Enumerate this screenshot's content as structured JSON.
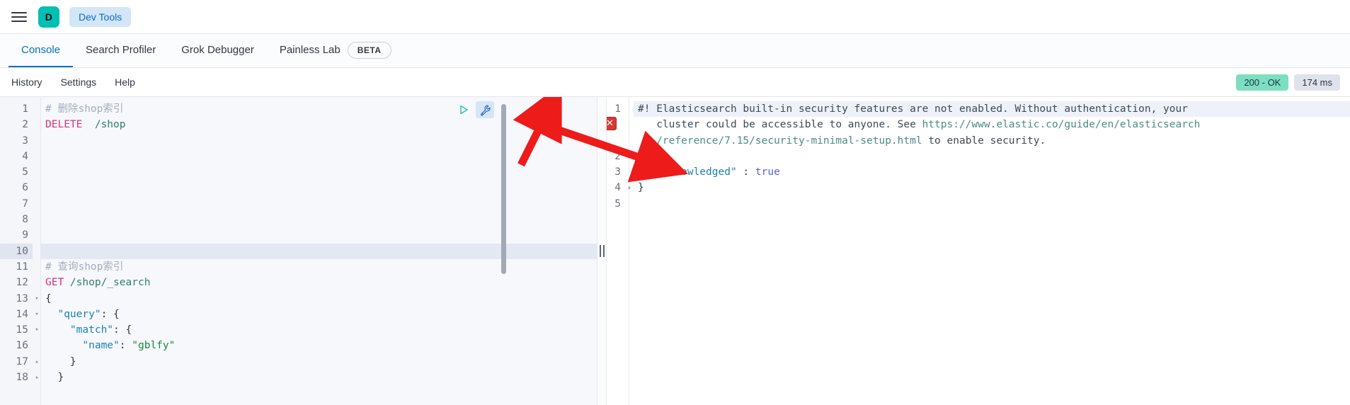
{
  "topbar": {
    "menu_icon": "hamburger-menu-icon",
    "avatar_letter": "D",
    "breadcrumb": "Dev Tools"
  },
  "tabs": [
    {
      "label": "Console",
      "active": true
    },
    {
      "label": "Search Profiler",
      "active": false
    },
    {
      "label": "Grok Debugger",
      "active": false
    },
    {
      "label": "Painless Lab",
      "active": false,
      "badge": "BETA"
    }
  ],
  "actions": {
    "links": [
      "History",
      "Settings",
      "Help"
    ],
    "status_code": "200 - OK",
    "duration": "174 ms",
    "play_icon": "play-triangle-icon",
    "wrench_icon": "wrench-icon"
  },
  "colors": {
    "accent_blue": "#0071c2",
    "teal_avatar": "#00BFB3",
    "status_ok_bg": "#7DDEC0",
    "status_time_bg": "#dfe2ea",
    "error_red": "#d63b33",
    "annotation_red": "#ee1b1b"
  },
  "request_editor": {
    "lines": [
      {
        "n": "1",
        "fold": "",
        "active": false,
        "tokens": [
          {
            "t": "# 删除shop索引",
            "c": "c-comment"
          }
        ]
      },
      {
        "n": "2",
        "fold": "",
        "active": false,
        "tokens": [
          {
            "t": "DELETE",
            "c": "c-method"
          },
          {
            "t": "  /shop",
            "c": "c-url"
          }
        ]
      },
      {
        "n": "3",
        "fold": "",
        "active": false,
        "tokens": []
      },
      {
        "n": "4",
        "fold": "",
        "active": false,
        "tokens": []
      },
      {
        "n": "5",
        "fold": "",
        "active": false,
        "tokens": []
      },
      {
        "n": "6",
        "fold": "",
        "active": false,
        "tokens": []
      },
      {
        "n": "7",
        "fold": "",
        "active": false,
        "tokens": []
      },
      {
        "n": "8",
        "fold": "",
        "active": false,
        "tokens": []
      },
      {
        "n": "9",
        "fold": "",
        "active": false,
        "tokens": []
      },
      {
        "n": "10",
        "fold": "",
        "active": true,
        "tokens": []
      },
      {
        "n": "11",
        "fold": "",
        "active": false,
        "tokens": [
          {
            "t": "# 查询shop索引",
            "c": "c-comment"
          }
        ]
      },
      {
        "n": "12",
        "fold": "",
        "active": false,
        "tokens": [
          {
            "t": "GET",
            "c": "c-method"
          },
          {
            "t": " /shop/_search",
            "c": "c-url"
          }
        ]
      },
      {
        "n": "13",
        "fold": "▾",
        "active": false,
        "tokens": [
          {
            "t": "{",
            "c": "c-punc"
          }
        ]
      },
      {
        "n": "14",
        "fold": "▾",
        "active": false,
        "tokens": [
          {
            "t": "  ",
            "c": "c-punc"
          },
          {
            "t": "\"query\"",
            "c": "c-key"
          },
          {
            "t": ": {",
            "c": "c-punc"
          }
        ]
      },
      {
        "n": "15",
        "fold": "▾",
        "active": false,
        "tokens": [
          {
            "t": "    ",
            "c": "c-punc"
          },
          {
            "t": "\"match\"",
            "c": "c-key"
          },
          {
            "t": ": {",
            "c": "c-punc"
          }
        ]
      },
      {
        "n": "16",
        "fold": "",
        "active": false,
        "tokens": [
          {
            "t": "      ",
            "c": "c-punc"
          },
          {
            "t": "\"name\"",
            "c": "c-key"
          },
          {
            "t": ": ",
            "c": "c-punc"
          },
          {
            "t": "\"gblfy\"",
            "c": "c-string"
          }
        ]
      },
      {
        "n": "17",
        "fold": "▴",
        "active": false,
        "tokens": [
          {
            "t": "    }",
            "c": "c-punc"
          }
        ]
      },
      {
        "n": "18",
        "fold": "▴",
        "active": false,
        "tokens": [
          {
            "t": "  }",
            "c": "c-punc"
          }
        ]
      }
    ]
  },
  "response_editor": {
    "lines": [
      {
        "n": "1",
        "fold": "",
        "warn": true,
        "tokens": [
          {
            "t": "#! Elasticsearch built-in security features are not enabled. Without authentication, your",
            "c": "c-warn"
          }
        ]
      },
      {
        "n": "",
        "fold": "",
        "warn": false,
        "tokens": [
          {
            "t": "   cluster could be accessible to anyone. See ",
            "c": "c-warn"
          },
          {
            "t": "https://www.elastic.co/guide/en/elasticsearch",
            "c": "c-link"
          }
        ]
      },
      {
        "n": "",
        "fold": "",
        "warn": false,
        "tokens": [
          {
            "t": "   ",
            "c": "c-warn"
          },
          {
            "t": "/reference/7.15/security-minimal-setup.html",
            "c": "c-link"
          },
          {
            "t": " to enable security.",
            "c": "c-warn"
          }
        ]
      },
      {
        "n": "2",
        "fold": "",
        "warn": false,
        "tokens": [
          {
            "t": "{",
            "c": "c-punc"
          }
        ]
      },
      {
        "n": "3",
        "fold": "",
        "warn": false,
        "tokens": [
          {
            "t": "  ",
            "c": "c-punc"
          },
          {
            "t": "\"acknowledged\"",
            "c": "c-key"
          },
          {
            "t": " : ",
            "c": "c-punc"
          },
          {
            "t": "true",
            "c": "c-bool"
          }
        ]
      },
      {
        "n": "4",
        "fold": "▴",
        "warn": false,
        "tokens": [
          {
            "t": "}",
            "c": "c-punc"
          }
        ]
      },
      {
        "n": "5",
        "fold": "",
        "warn": false,
        "tokens": []
      }
    ]
  }
}
